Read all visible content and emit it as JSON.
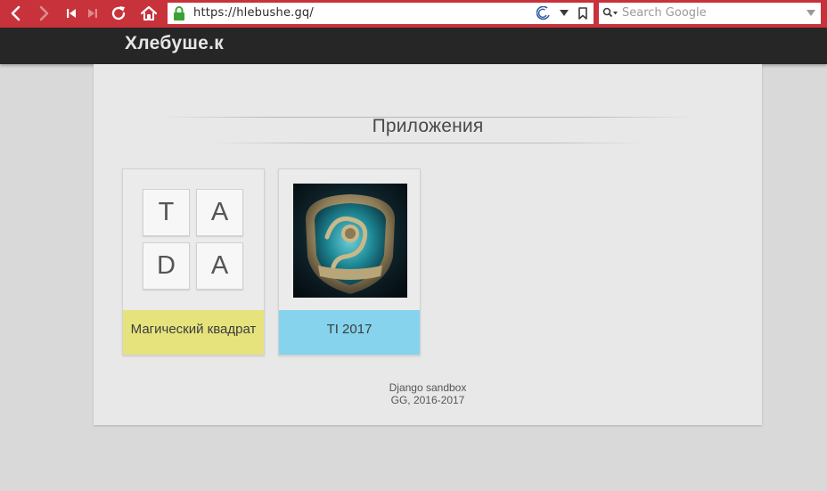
{
  "browser": {
    "url": "https://hlebushe.gq/",
    "search_placeholder": "Search Google",
    "accent_color": "#c8323b"
  },
  "site": {
    "logo": "Хлебуше.к"
  },
  "main": {
    "section_title": "Приложения",
    "apps": [
      {
        "label": "Магический квадрат",
        "tiles": [
          "T",
          "A",
          "D",
          "A"
        ],
        "color": "#e6e37d"
      },
      {
        "label": "TI 2017",
        "image": "aegis-shield",
        "color": "#85d3ec"
      }
    ]
  },
  "footer": {
    "line1": "Django sandbox",
    "line2": "GG, 2016-2017"
  }
}
